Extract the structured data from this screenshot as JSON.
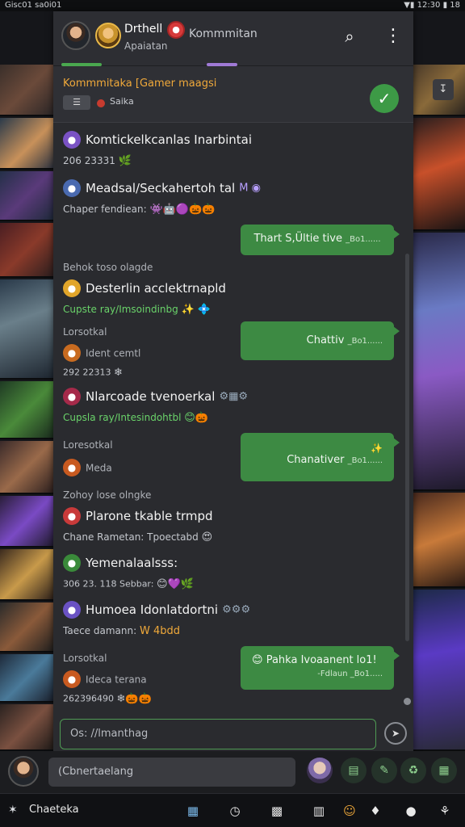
{
  "status": {
    "left": "Gisc01 sa0i01",
    "right": "▼▮ 12:30 ▮ 18"
  },
  "header": {
    "name": "Drthell",
    "sub": "Apaiatan",
    "title": "Kommmitan",
    "badge": "●",
    "search_icon": "⌕",
    "more_icon": "⋮"
  },
  "pinned": {
    "title": "Kommmitaka [Gamer maagsi",
    "chip": "☰",
    "meta": "Saika",
    "check_icon": "✓"
  },
  "messages": [
    {
      "name": "Komtickelkcanlas Inarbintai",
      "sub": "206 23331",
      "emo": "🌿",
      "icon_color": "#7a52c4"
    },
    {
      "name": "Meadsal/Seckahertoh tal",
      "sub": "Chaper fendiean:",
      "emo": "👾🤖🟣🎃🎃",
      "badges": "M ◉",
      "icon_color": "#4a6ab0"
    },
    {
      "bubble": "Thart S,Ültie tive",
      "bubble_meta": "_Bo1......"
    },
    {
      "label": "Behok toso olagde",
      "name": "Desterlin acclektrnapld",
      "sub": "Cupste ray/Imsoindinbg",
      "emo": "✨ 💠",
      "icon_color": "#e1a52a"
    },
    {
      "label": "Lorsotkal",
      "name": "Ident cemtl",
      "sub": "292 22313",
      "emo": "❄",
      "bubble": "Chattiv",
      "bubble_meta": "_Bo1......",
      "icon_color": "#c86b20"
    },
    {
      "name": "Nlarcoade tvenoerkal",
      "sub": "Cupsla ray/Intesindohtbl",
      "emo": "😊🎃",
      "badges": "⚙▦⚙",
      "icon_color": "#a52a4a"
    },
    {
      "label": "Loresotkal",
      "name": "Meda",
      "bubble": "Chanativer",
      "bubble_meta": "_Bo1......",
      "bubble_icon": "✨",
      "icon_color": "#c85a20"
    },
    {
      "label": "Zohoy lose olngke",
      "name": "Plarone tkable trmpd",
      "sub": "Chane Rametan: Tpoectabd",
      "emo": "😍",
      "icon_color": "#c83a3a"
    },
    {
      "name": "Yemenalaalsss:",
      "sub": "306 23. 118 Sebbar:",
      "emo": "😊💜🌿",
      "icon_color": "#3a8a3a"
    },
    {
      "name": "Humoea Idonlatdortni",
      "sub": "Taece damann:",
      "emo": "W 4bdd",
      "badges": "⚙⚙⚙",
      "icon_color": "#6a52c4"
    },
    {
      "label": "Lorsotkal",
      "name": "Ideca terana",
      "sub": "262396490",
      "emo": "❄🎃🎃",
      "bubble": "Pahka Ivoaanent lo1!",
      "bubble_sub": "-Fdlaun _Bo1.....",
      "bubble_icon": "😊",
      "icon_color": "#c85a20"
    }
  ],
  "input": {
    "placeholder": "Os: //lmanthag",
    "send_icon": "➤"
  },
  "bottom": {
    "field": "(Cbnertaelang",
    "btn1": "▤",
    "btn2": "✎",
    "btn3": "♻",
    "btn4": "▦"
  },
  "nav": {
    "logo": "✶",
    "app": "Chaeteka",
    "icons": [
      "▦",
      "◷",
      "▩",
      "▥",
      "☺",
      "♦",
      "●",
      "⚘"
    ]
  },
  "colors": {
    "accent_green": "#3d8a43",
    "accent_orange": "#f0a93a",
    "accent_purple": "#a07ad6"
  }
}
